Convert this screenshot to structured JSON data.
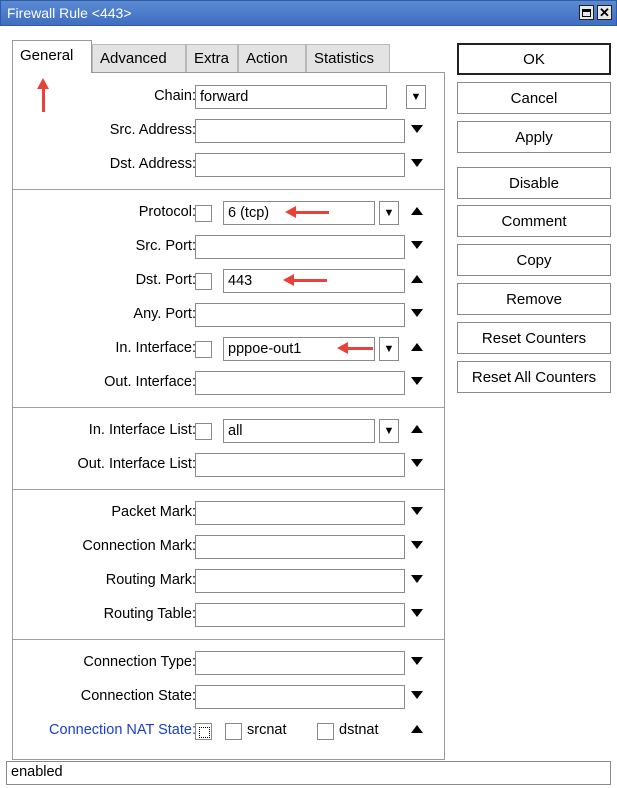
{
  "window": {
    "title": "Firewall Rule <443>"
  },
  "tabs": [
    {
      "label": "General",
      "active": true
    },
    {
      "label": "Advanced",
      "active": false
    },
    {
      "label": "Extra",
      "active": false
    },
    {
      "label": "Action",
      "active": false
    },
    {
      "label": "Statistics",
      "active": false
    }
  ],
  "fields": {
    "chain": {
      "label": "Chain:",
      "value": "forward"
    },
    "src_address": {
      "label": "Src. Address:",
      "value": ""
    },
    "dst_address": {
      "label": "Dst. Address:",
      "value": ""
    },
    "protocol": {
      "label": "Protocol:",
      "value": "6 (tcp)"
    },
    "src_port": {
      "label": "Src. Port:",
      "value": ""
    },
    "dst_port": {
      "label": "Dst. Port:",
      "value": "443"
    },
    "any_port": {
      "label": "Any. Port:",
      "value": ""
    },
    "in_interface": {
      "label": "In. Interface:",
      "value": "pppoe-out1"
    },
    "out_interface": {
      "label": "Out. Interface:",
      "value": ""
    },
    "in_interface_list": {
      "label": "In. Interface List:",
      "value": "all"
    },
    "out_interface_list": {
      "label": "Out. Interface List:",
      "value": ""
    },
    "packet_mark": {
      "label": "Packet Mark:",
      "value": ""
    },
    "connection_mark": {
      "label": "Connection Mark:",
      "value": ""
    },
    "routing_mark": {
      "label": "Routing Mark:",
      "value": ""
    },
    "routing_table": {
      "label": "Routing Table:",
      "value": ""
    },
    "connection_type": {
      "label": "Connection Type:",
      "value": ""
    },
    "connection_state": {
      "label": "Connection State:",
      "value": ""
    },
    "connection_nat_state": {
      "label": "Connection NAT State:",
      "option1": "srcnat",
      "option2": "dstnat"
    }
  },
  "buttons": {
    "ok": "OK",
    "cancel": "Cancel",
    "apply": "Apply",
    "disable": "Disable",
    "comment": "Comment",
    "copy": "Copy",
    "remove": "Remove",
    "reset_counters": "Reset Counters",
    "reset_all_counters": "Reset All Counters"
  },
  "status": {
    "text": "enabled"
  },
  "colors": {
    "title_bar": "#4a7ccc",
    "annotation_arrow": "#e8413a",
    "nat_label": "#1a3ecf"
  }
}
